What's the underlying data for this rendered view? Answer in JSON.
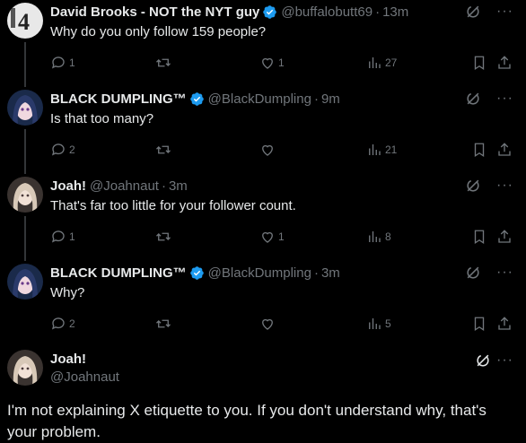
{
  "replies": [
    {
      "name": "David Brooks - NOT the NYT guy",
      "verified": true,
      "handle": "@buffalobutt69",
      "time": "13m",
      "text": "Why do you only follow 159 people?",
      "replies": "1",
      "reposts": "",
      "likes": "1",
      "views": "27",
      "avatar_icon": "david-avatar"
    },
    {
      "name": "BLACK DUMPLING™",
      "verified": true,
      "handle": "@BlackDumpling",
      "time": "9m",
      "text": "Is that too many?",
      "replies": "2",
      "reposts": "",
      "likes": "",
      "views": "21",
      "avatar_icon": "anime-avatar"
    },
    {
      "name": "Joah!",
      "verified": false,
      "handle": "@Joahnaut",
      "time": "3m",
      "text": "That's far too little for your follower count.",
      "replies": "1",
      "reposts": "",
      "likes": "1",
      "views": "8",
      "avatar_icon": "joah-avatar"
    },
    {
      "name": "BLACK DUMPLING™",
      "verified": true,
      "handle": "@BlackDumpling",
      "time": "3m",
      "text": "Why?",
      "replies": "2",
      "reposts": "",
      "likes": "",
      "views": "5",
      "avatar_icon": "anime-avatar"
    }
  ],
  "main": {
    "name": "Joah!",
    "handle": "@Joahnaut",
    "text": "I'm not explaining X etiquette to you. If you don't understand why, that's your problem."
  },
  "colors": {
    "background": "#000000",
    "text": "#e7e9ea",
    "muted": "#71767b",
    "verified": "#1d9bf0",
    "thread_line": "#333639"
  },
  "separator": "·",
  "more_glyph": "···"
}
